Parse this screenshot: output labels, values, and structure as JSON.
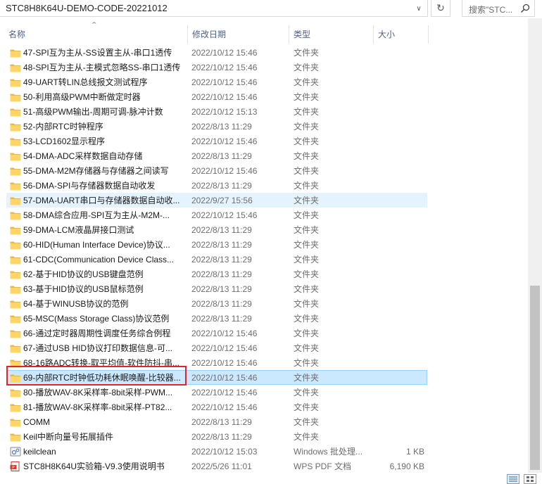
{
  "address": {
    "path": "STC8H8K64U-DEMO-CODE-20221012",
    "dropdown_icon": "chevron-down-icon",
    "refresh_icon": "refresh-icon"
  },
  "search": {
    "placeholder": "搜索\"STC...",
    "icon": "search-icon"
  },
  "columns": {
    "name": "名称",
    "date": "修改日期",
    "type": "类型",
    "size": "大小"
  },
  "files": [
    {
      "name": "47-SPI互为主从-SS设置主从-串口1透传",
      "date": "2022/10/12 15:46",
      "type": "文件夹",
      "size": "",
      "icon": "folder"
    },
    {
      "name": "48-SPI互为主从-主模式忽略SS-串口1透传",
      "date": "2022/10/12 15:46",
      "type": "文件夹",
      "size": "",
      "icon": "folder"
    },
    {
      "name": "49-UART转LIN总线报文测试程序",
      "date": "2022/10/12 15:46",
      "type": "文件夹",
      "size": "",
      "icon": "folder"
    },
    {
      "name": "50-利用高级PWM中断做定时器",
      "date": "2022/10/12 15:46",
      "type": "文件夹",
      "size": "",
      "icon": "folder"
    },
    {
      "name": "51-高级PWM输出-周期可调-脉冲计数",
      "date": "2022/10/12 15:13",
      "type": "文件夹",
      "size": "",
      "icon": "folder"
    },
    {
      "name": "52-内部RTC时钟程序",
      "date": "2022/8/13 11:29",
      "type": "文件夹",
      "size": "",
      "icon": "folder"
    },
    {
      "name": "53-LCD1602显示程序",
      "date": "2022/10/12 15:46",
      "type": "文件夹",
      "size": "",
      "icon": "folder"
    },
    {
      "name": "54-DMA-ADC采样数据自动存储",
      "date": "2022/8/13 11:29",
      "type": "文件夹",
      "size": "",
      "icon": "folder"
    },
    {
      "name": "55-DMA-M2M存储器与存储器之间读写",
      "date": "2022/10/12 15:46",
      "type": "文件夹",
      "size": "",
      "icon": "folder"
    },
    {
      "name": "56-DMA-SPI与存储器数据自动收发",
      "date": "2022/8/13 11:29",
      "type": "文件夹",
      "size": "",
      "icon": "folder"
    },
    {
      "name": "57-DMA-UART串口与存储器数据自动收...",
      "date": "2022/9/27 15:56",
      "type": "文件夹",
      "size": "",
      "icon": "folder",
      "state": "hover"
    },
    {
      "name": "58-DMA综合应用-SPI互为主从-M2M-...",
      "date": "2022/10/12 15:46",
      "type": "文件夹",
      "size": "",
      "icon": "folder"
    },
    {
      "name": "59-DMA-LCM液晶屏接口测试",
      "date": "2022/8/13 11:29",
      "type": "文件夹",
      "size": "",
      "icon": "folder"
    },
    {
      "name": "60-HID(Human Interface Device)协议...",
      "date": "2022/8/13 11:29",
      "type": "文件夹",
      "size": "",
      "icon": "folder"
    },
    {
      "name": "61-CDC(Communication Device Class...",
      "date": "2022/8/13 11:29",
      "type": "文件夹",
      "size": "",
      "icon": "folder"
    },
    {
      "name": "62-基于HID协议的USB键盘范例",
      "date": "2022/8/13 11:29",
      "type": "文件夹",
      "size": "",
      "icon": "folder"
    },
    {
      "name": "63-基于HID协议的USB鼠标范例",
      "date": "2022/8/13 11:29",
      "type": "文件夹",
      "size": "",
      "icon": "folder"
    },
    {
      "name": "64-基于WINUSB协议的范例",
      "date": "2022/8/13 11:29",
      "type": "文件夹",
      "size": "",
      "icon": "folder"
    },
    {
      "name": "65-MSC(Mass Storage Class)协议范例",
      "date": "2022/8/13 11:29",
      "type": "文件夹",
      "size": "",
      "icon": "folder"
    },
    {
      "name": "66-通过定时器周期性调度任务综合例程",
      "date": "2022/10/12 15:46",
      "type": "文件夹",
      "size": "",
      "icon": "folder"
    },
    {
      "name": "67-通过USB HID协议打印数据信息-可...",
      "date": "2022/10/12 15:46",
      "type": "文件夹",
      "size": "",
      "icon": "folder"
    },
    {
      "name": "68-16路ADC转换-取平均值-软件防抖-串...",
      "date": "2022/10/12 15:46",
      "type": "文件夹",
      "size": "",
      "icon": "folder"
    },
    {
      "name": "69-内部RTC时钟低功耗休眠唤醒-比较器...",
      "date": "2022/10/12 15:46",
      "type": "文件夹",
      "size": "",
      "icon": "folder",
      "state": "selected"
    },
    {
      "name": "80-播放WAV-8K采样率-8bit采样-PWM...",
      "date": "2022/10/12 15:46",
      "type": "文件夹",
      "size": "",
      "icon": "folder"
    },
    {
      "name": "81-播放WAV-8K采样率-8bit采样-PT82...",
      "date": "2022/10/12 15:46",
      "type": "文件夹",
      "size": "",
      "icon": "folder"
    },
    {
      "name": "COMM",
      "date": "2022/8/13 11:29",
      "type": "文件夹",
      "size": "",
      "icon": "folder"
    },
    {
      "name": "Keil中断向量号拓展插件",
      "date": "2022/8/13 11:29",
      "type": "文件夹",
      "size": "",
      "icon": "folder"
    },
    {
      "name": "keilclean",
      "date": "2022/10/12 15:03",
      "type": "Windows 批处理...",
      "size": "1 KB",
      "icon": "batch-file"
    },
    {
      "name": "STC8H8K64U实验箱-V9.3使用说明书",
      "date": "2022/5/26 11:01",
      "type": "WPS PDF 文档",
      "size": "6,190 KB",
      "icon": "pdf-file"
    }
  ],
  "view_buttons": [
    "details-view-icon",
    "large-icons-view-icon"
  ]
}
